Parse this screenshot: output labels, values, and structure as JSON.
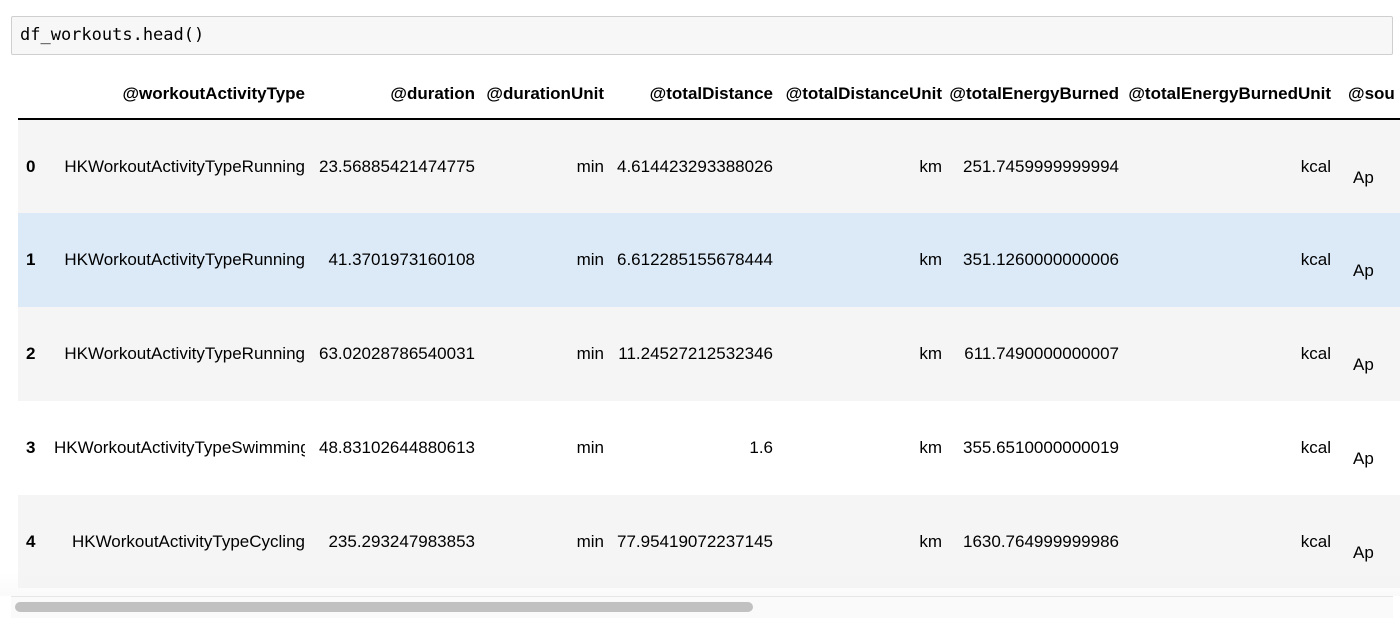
{
  "code_cell": {
    "code": "df_workouts.head()"
  },
  "dataframe": {
    "columns": [
      "@workoutActivityType",
      "@duration",
      "@durationUnit",
      "@totalDistance",
      "@totalDistanceUnit",
      "@totalEnergyBurned",
      "@totalEnergyBurnedUnit",
      "@sou"
    ],
    "rows": [
      {
        "index": "0",
        "cells": [
          "HKWorkoutActivityTypeRunning",
          "23.56885421474775",
          "min",
          "4.614423293388026",
          "km",
          "251.7459999999994",
          "kcal",
          "Ap"
        ]
      },
      {
        "index": "1",
        "cells": [
          "HKWorkoutActivityTypeRunning",
          "41.3701973160108",
          "min",
          "6.612285155678444",
          "km",
          "351.1260000000006",
          "kcal",
          "Ap"
        ]
      },
      {
        "index": "2",
        "cells": [
          "HKWorkoutActivityTypeRunning",
          "63.02028786540031",
          "min",
          "11.24527212532346",
          "km",
          "611.7490000000007",
          "kcal",
          "Ap"
        ]
      },
      {
        "index": "3",
        "cells": [
          "HKWorkoutActivityTypeSwimming",
          "48.83102644880613",
          "min",
          "1.6",
          "km",
          "355.6510000000019",
          "kcal",
          "Ap"
        ]
      },
      {
        "index": "4",
        "cells": [
          "HKWorkoutActivityTypeCycling",
          "235.293247983853",
          "min",
          "77.95419072237145",
          "km",
          "1630.764999999986",
          "kcal",
          "Ap"
        ]
      }
    ]
  },
  "colors": {
    "row_even": "#f5f5f5",
    "row_odd": "#ffffff",
    "row_hover": "#dceaf8",
    "scroll_thumb": "#c1c1c1"
  }
}
